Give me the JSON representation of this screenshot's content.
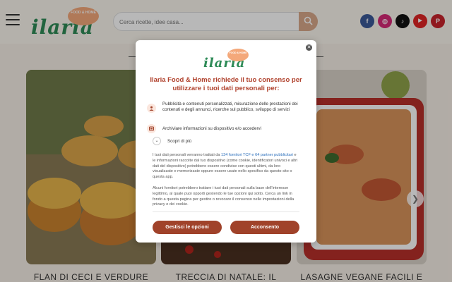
{
  "header": {
    "logo_text": "ilaria",
    "logo_badge": "FOOD & HOME",
    "search_placeholder": "Cerca ricette, idee casa...",
    "social": [
      {
        "name": "facebook-icon",
        "glyph": "f",
        "color": "#3b5998"
      },
      {
        "name": "instagram-icon",
        "glyph": "◎",
        "color": "#d62976"
      },
      {
        "name": "tiktok-icon",
        "glyph": "♪",
        "color": "#111111"
      },
      {
        "name": "youtube-icon",
        "glyph": "▶",
        "color": "#e02424"
      },
      {
        "name": "pinterest-icon",
        "glyph": "P",
        "color": "#c8232c"
      }
    ]
  },
  "cards": [
    {
      "title": "FLAN DI CECI E VERDURE"
    },
    {
      "title": "TRECCIA DI NATALE: IL"
    },
    {
      "title": "LASAGNE VEGANE FACILI E"
    }
  ],
  "modal": {
    "logo_text": "ilaria",
    "logo_badge": "FOOD & HOME",
    "title": "Ilaria Food & Home richiede il tuo consenso per utilizzare i tuoi dati personali per:",
    "purposes": [
      {
        "icon": "user-profile-icon",
        "text": "Pubblicità e contenuti personalizzati, misurazione delle prestazioni dei contenuti e degli annunci, ricerche sul pubblico, sviluppo di servizi"
      },
      {
        "icon": "device-storage-icon",
        "text": "Archiviare informazioni su dispositivo e/o accedervi"
      }
    ],
    "more_label": "Scopri di più",
    "info1_before": "I tuoi dati personali verranno trattati da ",
    "info1_link": "134 fornitori TCF e 64 partner pubblicitari",
    "info1_after": " e le informazioni raccolte dal tuo dispositivo (come cookie, identificatori univoci e altri dati del dispositivo) potrebbero essere condivise con questi ultimi, da loro visualizzate e memorizzate oppure essere usate nello specifico da questo sito o questa app.",
    "info2": "Alcuni fornitori potrebbero trattare i tuoi dati personali sulla base dell'interesse legittimo, al quale puoi opporti gestendo le tue opzioni qui sotto. Cerca un link in fondo a questa pagina per gestire o revocare il consenso nelle impostazioni della privacy e dei cookie.",
    "manage_button": "Gestisci le opzioni",
    "accept_button": "Acconsento",
    "accent": "#a0422a"
  }
}
